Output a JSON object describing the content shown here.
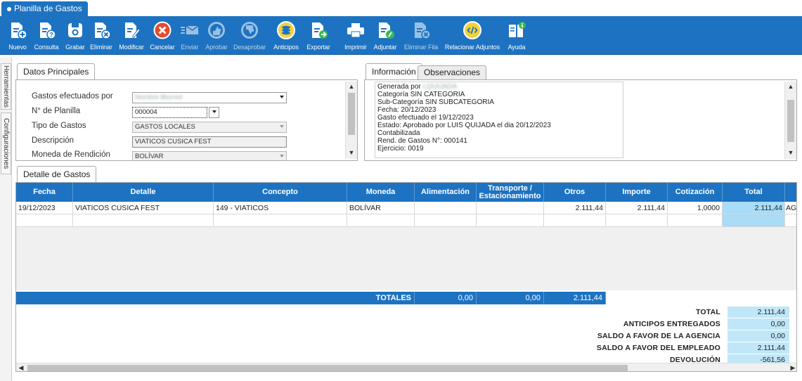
{
  "window_tab": {
    "title": "Planilla de Gastos"
  },
  "toolbar": [
    {
      "id": "nuevo",
      "label": "Nuevo",
      "icon": "new-doc-icon",
      "enabled": true
    },
    {
      "id": "consulta",
      "label": "Consulta",
      "icon": "query-doc-icon",
      "enabled": true
    },
    {
      "id": "grabar",
      "label": "Grabar",
      "icon": "save-icon",
      "enabled": true
    },
    {
      "id": "eliminar",
      "label": "Eliminar",
      "icon": "delete-doc-icon",
      "enabled": true
    },
    {
      "id": "modificar",
      "label": "Modificar",
      "icon": "edit-doc-icon",
      "enabled": true
    },
    {
      "id": "cancelar",
      "label": "Cancelar",
      "icon": "cancel-icon",
      "enabled": true
    },
    {
      "id": "enviar",
      "label": "Enviar",
      "icon": "send-mail-icon",
      "enabled": false
    },
    {
      "id": "aprobar",
      "label": "Aprobar",
      "icon": "thumbs-up-icon",
      "enabled": false
    },
    {
      "id": "desaprobar",
      "label": "Desaprobar",
      "icon": "thumbs-down-icon",
      "enabled": false
    },
    {
      "id": "anticipos",
      "label": "Anticipos",
      "icon": "coins-icon",
      "enabled": true
    },
    {
      "id": "exportar",
      "label": "Exportar",
      "icon": "export-icon",
      "enabled": true
    },
    {
      "id": "imprimir",
      "label": "Imprimir",
      "icon": "printer-icon",
      "enabled": true
    },
    {
      "id": "adjuntar",
      "label": "Adjuntar",
      "icon": "attach-doc-icon",
      "enabled": true
    },
    {
      "id": "eliminar_fila",
      "label": "Eliminar Fila",
      "icon": "delete-row-icon",
      "enabled": false
    },
    {
      "id": "relacionar",
      "label": "Relacionar Adjuntos",
      "icon": "link-attachments-icon",
      "enabled": true
    },
    {
      "id": "ayuda",
      "label": "Ayuda",
      "icon": "help-book-icon",
      "enabled": true
    }
  ],
  "side_tabs": [
    "Herramientas",
    "Configuraciones"
  ],
  "datos": {
    "tab": "Datos Principales",
    "fields": [
      {
        "label": "Gastos efectuados por",
        "value": "Nombre Blurred",
        "type": "select",
        "blurred": true
      },
      {
        "label": "N° de Planilla",
        "value": "000004",
        "type": "select"
      },
      {
        "label": "Tipo de Gastos",
        "value": "GASTOS LOCALES",
        "type": "select-readonly"
      },
      {
        "label": "Descripción",
        "value": "VIATICOS CUSICA FEST",
        "type": "text-readonly"
      },
      {
        "label": "Moneda de Rendición",
        "value": "BOLÍVAR",
        "type": "select-readonly"
      }
    ]
  },
  "info": {
    "tabs": [
      "Información",
      "Observaciones"
    ],
    "lines": [
      {
        "prefix": "Generada por ",
        "blurred": "LQUIJADA"
      },
      {
        "text": "Categoría SIN CATEGORIA"
      },
      {
        "text": "Sub-Categoría SIN SUBCATEGORIA"
      },
      {
        "text": "Fecha: 20/12/2023"
      },
      {
        "text": "Gasto efectuado el 19/12/2023"
      },
      {
        "text": "Estado: Aprobado por LUIS QUIJADA el dia 20/12/2023"
      },
      {
        "text": "Contabilizada"
      },
      {
        "text": "Rend. de Gastos N°: 000141"
      },
      {
        "text": "Ejercicio: 0019"
      }
    ]
  },
  "detalle": {
    "tab": "Detalle de Gastos",
    "columns": [
      "Fecha",
      "Detalle",
      "Concepto",
      "Moneda",
      "Alimentación",
      "Transporte / Estacionamiento",
      "Otros",
      "Importe",
      "Cotización",
      "Total"
    ],
    "rows": [
      {
        "fecha": "19/12/2023",
        "detalle": "VIATICOS CUSICA FEST",
        "concepto": "149 - VIATICOS",
        "moneda": "BOLÍVAR",
        "alimentacion": "",
        "transporte": "",
        "otros": "2.111,44",
        "importe": "2.111,44",
        "cotizacion": "1,0000",
        "total": "2.111,44",
        "extra": "AG"
      }
    ],
    "totales": {
      "label": "TOTALES",
      "alimentacion": "0,00",
      "transporte": "0,00",
      "otros": "2.111,44"
    },
    "summary": [
      {
        "label": "TOTAL",
        "value": "2.111,44"
      },
      {
        "label": "ANTICIPOS ENTREGADOS",
        "value": "0,00"
      },
      {
        "label": "SALDO A FAVOR DE LA AGENCIA",
        "value": "0,00"
      },
      {
        "label": "SALDO A FAVOR DEL EMPLEADO",
        "value": "2.111,44"
      },
      {
        "label": "DEVOLUCIÓN",
        "value": "-561,56"
      }
    ]
  },
  "colors": {
    "primary": "#1d73c2",
    "total_cell": "#a9dcf7",
    "summary_cell": "#bfe7f8"
  }
}
